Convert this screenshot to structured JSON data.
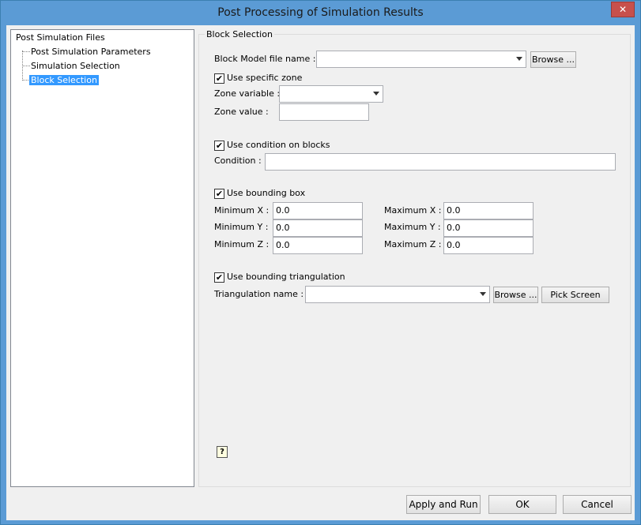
{
  "window": {
    "title": "Post Processing of Simulation Results",
    "close_glyph": "✕"
  },
  "tree": {
    "root": "Post Simulation Files",
    "items": [
      {
        "label": "Post Simulation Parameters",
        "selected": false
      },
      {
        "label": "Simulation Selection",
        "selected": false
      },
      {
        "label": "Block Selection",
        "selected": true
      }
    ]
  },
  "panel": {
    "group_title": "Block Selection",
    "block_model": {
      "label": "Block Model file name :",
      "value": "",
      "browse_label": "Browse ..."
    },
    "specific_zone": {
      "checkbox_label": "Use specific zone",
      "checked": true,
      "zone_variable_label": "Zone variable :",
      "zone_variable_value": "",
      "zone_value_label": "Zone value :",
      "zone_value": ""
    },
    "condition": {
      "checkbox_label": "Use condition on blocks",
      "checked": true,
      "label": "Condition :",
      "value": ""
    },
    "bounding_box": {
      "checkbox_label": "Use bounding box",
      "checked": true,
      "min_x_label": "Minimum X :",
      "min_x": "0.0",
      "min_y_label": "Minimum Y :",
      "min_y": "0.0",
      "min_z_label": "Minimum Z :",
      "min_z": "0.0",
      "max_x_label": "Maximum X :",
      "max_x": "0.0",
      "max_y_label": "Maximum Y :",
      "max_y": "0.0",
      "max_z_label": "Maximum Z :",
      "max_z": "0.0"
    },
    "triangulation": {
      "checkbox_label": "Use bounding triangulation",
      "checked": true,
      "label": "Triangulation name :",
      "value": "",
      "browse_label": "Browse ...",
      "pick_label": "Pick Screen"
    },
    "check_glyph": "✔",
    "help_glyph": "?"
  },
  "footer": {
    "apply_label": "Apply and Run",
    "ok_label": "OK",
    "cancel_label": "Cancel"
  }
}
